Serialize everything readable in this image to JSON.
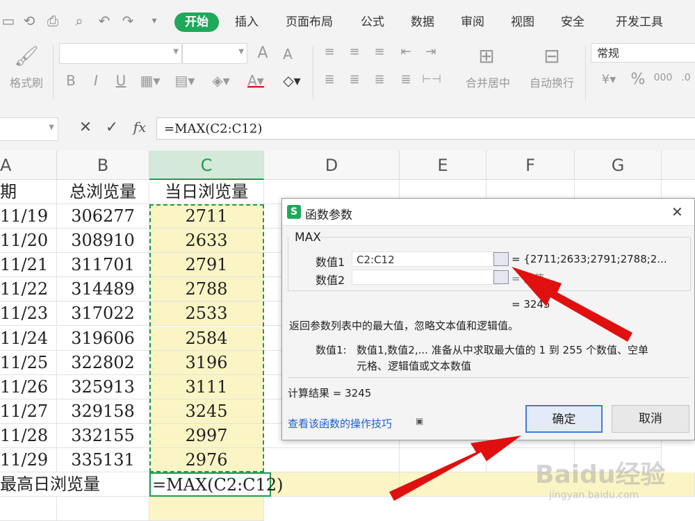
{
  "tabs": [
    {
      "label": "开始",
      "active": true
    },
    {
      "label": "插入"
    },
    {
      "label": "页面布局"
    },
    {
      "label": "公式"
    },
    {
      "label": "数据"
    },
    {
      "label": "审阅"
    },
    {
      "label": "视图"
    },
    {
      "label": "安全"
    },
    {
      "label": "开发工具"
    }
  ],
  "ribbon": {
    "format_painter": "格式刷",
    "merge_center": "合并居中",
    "wrap_text": "自动换行",
    "number_format": "常规",
    "bold": "B",
    "italic": "I",
    "underline": "U"
  },
  "formula_bar": {
    "cancel": "✕",
    "confirm": "✓",
    "fx": "fx",
    "formula": "=MAX(C2:C12)"
  },
  "columns": [
    "A",
    "B",
    "C",
    "D",
    "E",
    "F",
    "G"
  ],
  "headers": {
    "a": "期",
    "b": "总浏览量",
    "c": "当日浏览量"
  },
  "rows": [
    {
      "date": "11/19",
      "total": "306277",
      "daily": "2711"
    },
    {
      "date": "11/20",
      "total": "308910",
      "daily": "2633"
    },
    {
      "date": "11/21",
      "total": "311701",
      "daily": "2791"
    },
    {
      "date": "11/22",
      "total": "314489",
      "daily": "2788"
    },
    {
      "date": "11/23",
      "total": "317022",
      "daily": "2533"
    },
    {
      "date": "11/24",
      "total": "319606",
      "daily": "2584"
    },
    {
      "date": "11/25",
      "total": "322802",
      "daily": "3196"
    },
    {
      "date": "11/26",
      "total": "325913",
      "daily": "3111"
    },
    {
      "date": "11/27",
      "total": "329158",
      "daily": "3245"
    },
    {
      "date": "11/28",
      "total": "332155",
      "daily": "2997"
    },
    {
      "date": "11/29",
      "total": "335131",
      "daily": "2976"
    }
  ],
  "last_row": {
    "label": "最高日浏览量",
    "formula": "=MAX(C2:C12)"
  },
  "dialog": {
    "title": "函数参数",
    "close": "✕",
    "function_name": "MAX",
    "arg1_label": "数值1",
    "arg1_value": "C2:C12",
    "arg1_result": "= {2711;2633;2791;2788;2...",
    "arg2_label": "数值2",
    "arg2_value": "",
    "arg2_result": "= 数值",
    "result_preview": "= 3245",
    "description": "返回参数列表中的最大值，忽略文本值和逻辑值。",
    "arg_help_label": "数值1:",
    "arg_help_line1": "数值1,数值2,... 准备从中求取最大值的 1 到 255 个数值、空单",
    "arg_help_line2": "元格、逻辑值或文本数值",
    "calc_result": "计算结果 = 3245",
    "help_link": "查看该函数的操作技巧",
    "ok": "确定",
    "cancel": "取消"
  },
  "watermark": {
    "brand": "Baidu经验",
    "url": "jingyan.baidu.com"
  },
  "colors": {
    "accent": "#1fa85a",
    "highlight": "#fbf5c6",
    "arrow": "#e01010",
    "link": "#1a5fcc"
  }
}
